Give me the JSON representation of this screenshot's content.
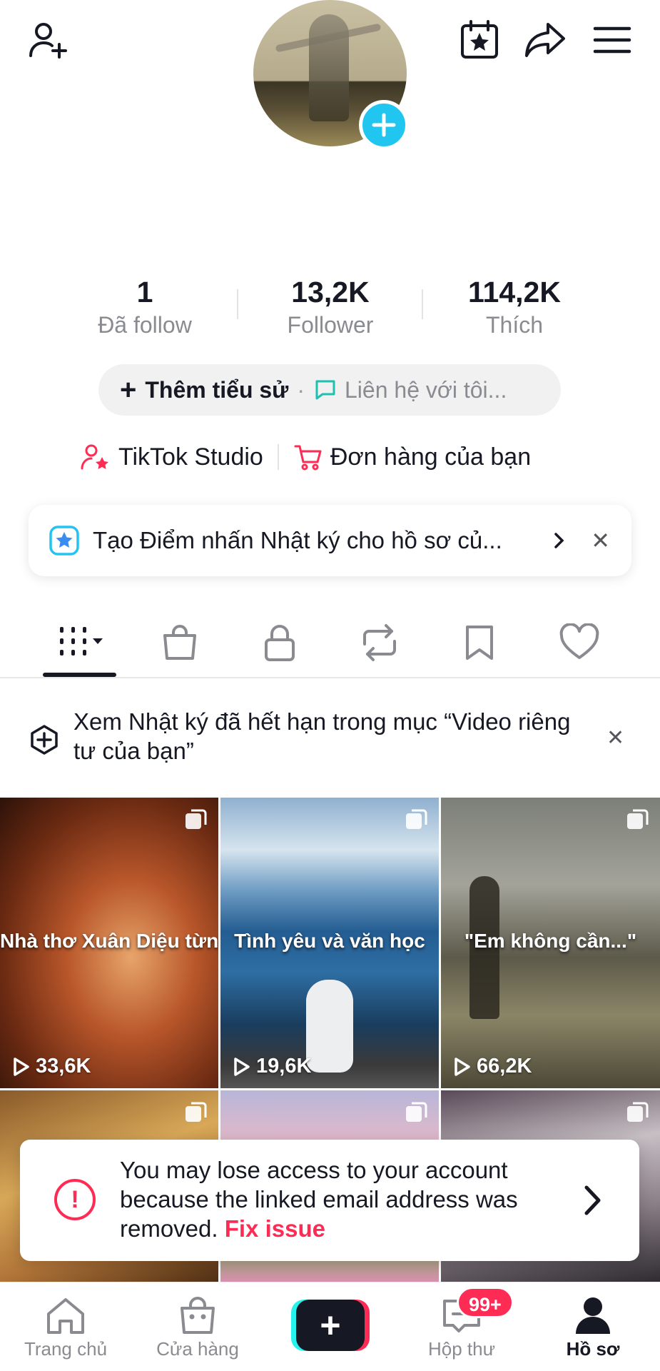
{
  "header": {
    "add_friend_icon": "person-plus-icon",
    "calendar_icon": "calendar-star-icon",
    "share_icon": "share-arrow-icon",
    "menu_icon": "hamburger-menu-icon"
  },
  "stats": [
    {
      "value": "1",
      "label": "Đã follow"
    },
    {
      "value": "13,2K",
      "label": "Follower"
    },
    {
      "value": "114,2K",
      "label": "Thích"
    }
  ],
  "bio": {
    "plus": "+",
    "add_bio": "Thêm tiểu sử",
    "separator": "·",
    "contact": "Liên hệ với tôi..."
  },
  "shortcuts": {
    "studio": "TikTok Studio",
    "orders": "Đơn hàng của bạn"
  },
  "banner": {
    "text": "Tạo Điểm nhấn Nhật ký cho hồ sơ củ...",
    "close": "✕"
  },
  "tabs": [
    "videos",
    "shop",
    "private",
    "reposts",
    "favorites",
    "liked"
  ],
  "expired_notice": {
    "text": "Xem Nhật ký đã hết hạn trong mục “Video riêng tư của bạn”",
    "close": "✕"
  },
  "videos": [
    {
      "caption": "Nhà thơ Xuân Diệu từng nó",
      "views": "33,6K"
    },
    {
      "caption": "Tình yêu và văn học",
      "views": "19,6K"
    },
    {
      "caption": "\"Em không cần...\"",
      "views": "66,2K"
    },
    {
      "caption": "",
      "views": ""
    },
    {
      "caption": "",
      "views": ""
    },
    {
      "caption": "",
      "views": ""
    }
  ],
  "alert": {
    "text": "You may lose access to your account because the linked email address was removed.",
    "action": "Fix issue",
    "icon": "!"
  },
  "bottom_nav": {
    "home": "Trang chủ",
    "shop": "Cửa hàng",
    "create": "+",
    "inbox": "Hộp thư",
    "inbox_badge": "99+",
    "profile": "Hồ sơ"
  },
  "colors": {
    "accent": "#fe2c55",
    "cyan": "#25f4ee",
    "avatar_plus": "#20c6ef",
    "text": "#161823",
    "muted": "#8a8b91"
  }
}
